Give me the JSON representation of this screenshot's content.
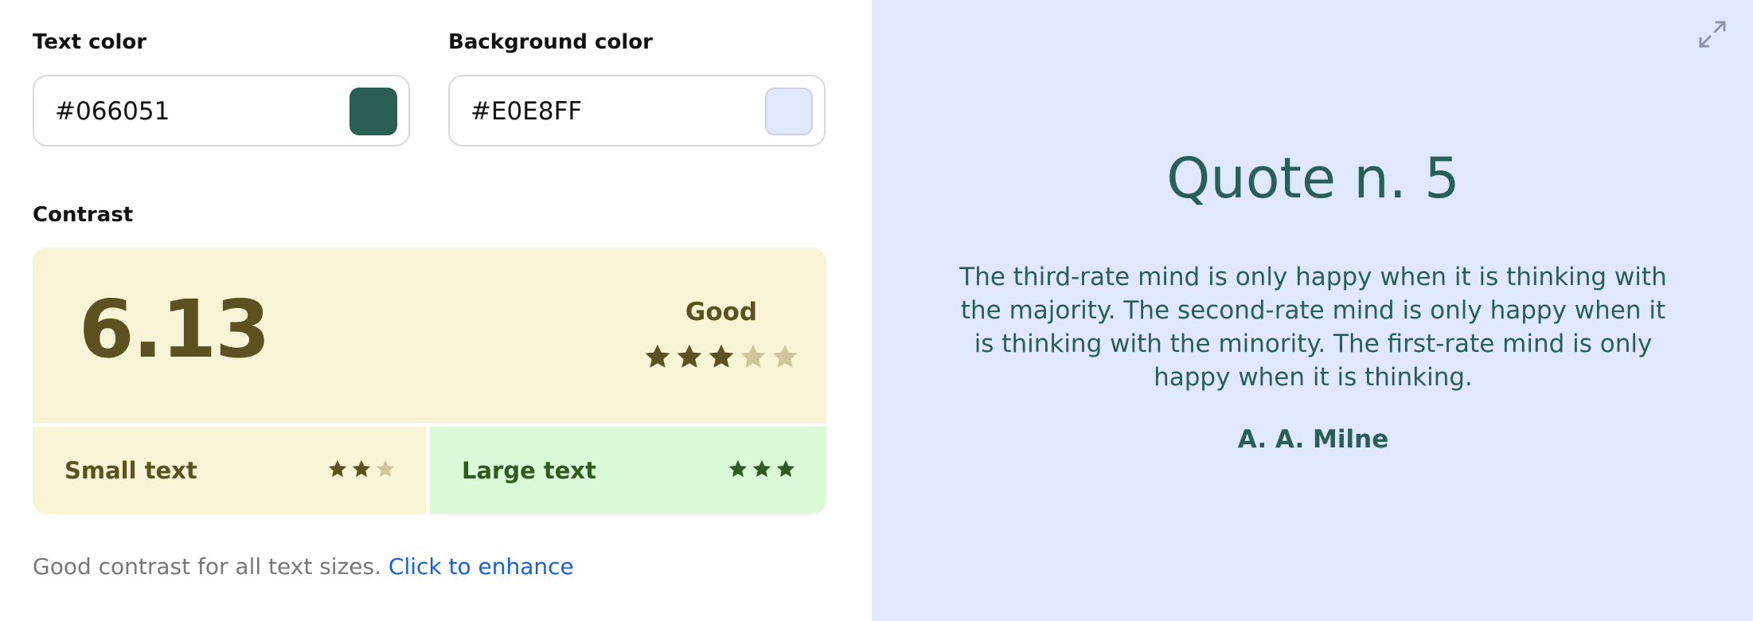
{
  "editor": {
    "text_color": {
      "label": "Text color",
      "value": "#066051",
      "swatch": "#2a5f55"
    },
    "background_color": {
      "label": "Background color",
      "value": "#E0E8FF",
      "swatch": "#E0E8FF"
    },
    "contrast_label": "Contrast"
  },
  "contrast": {
    "ratio": "6.13",
    "rating": "Good",
    "stars_filled": 3,
    "stars_total": 5,
    "small_text": {
      "label": "Small text",
      "stars_filled": 2,
      "stars_total": 3
    },
    "large_text": {
      "label": "Large text",
      "stars_filled": 3,
      "stars_total": 3
    },
    "colors": {
      "rating_text": "#5c5120",
      "rating_bg": "#F9F4D5",
      "star_empty": "#cfc6a0",
      "large_bg": "#DAF9D7",
      "large_text": "#2f5a22"
    }
  },
  "help": {
    "text": "Good contrast for all text sizes.",
    "link": "Click to enhance"
  },
  "preview": {
    "expand_icon": "expand-icon",
    "title": "Quote n. 5",
    "quote": "The third-rate mind is only happy when it is thinking with the majority. The second-rate mind is only happy when it is thinking with the minority. The first-rate mind is only happy when it is thinking.",
    "author": "A. A. Milne"
  }
}
